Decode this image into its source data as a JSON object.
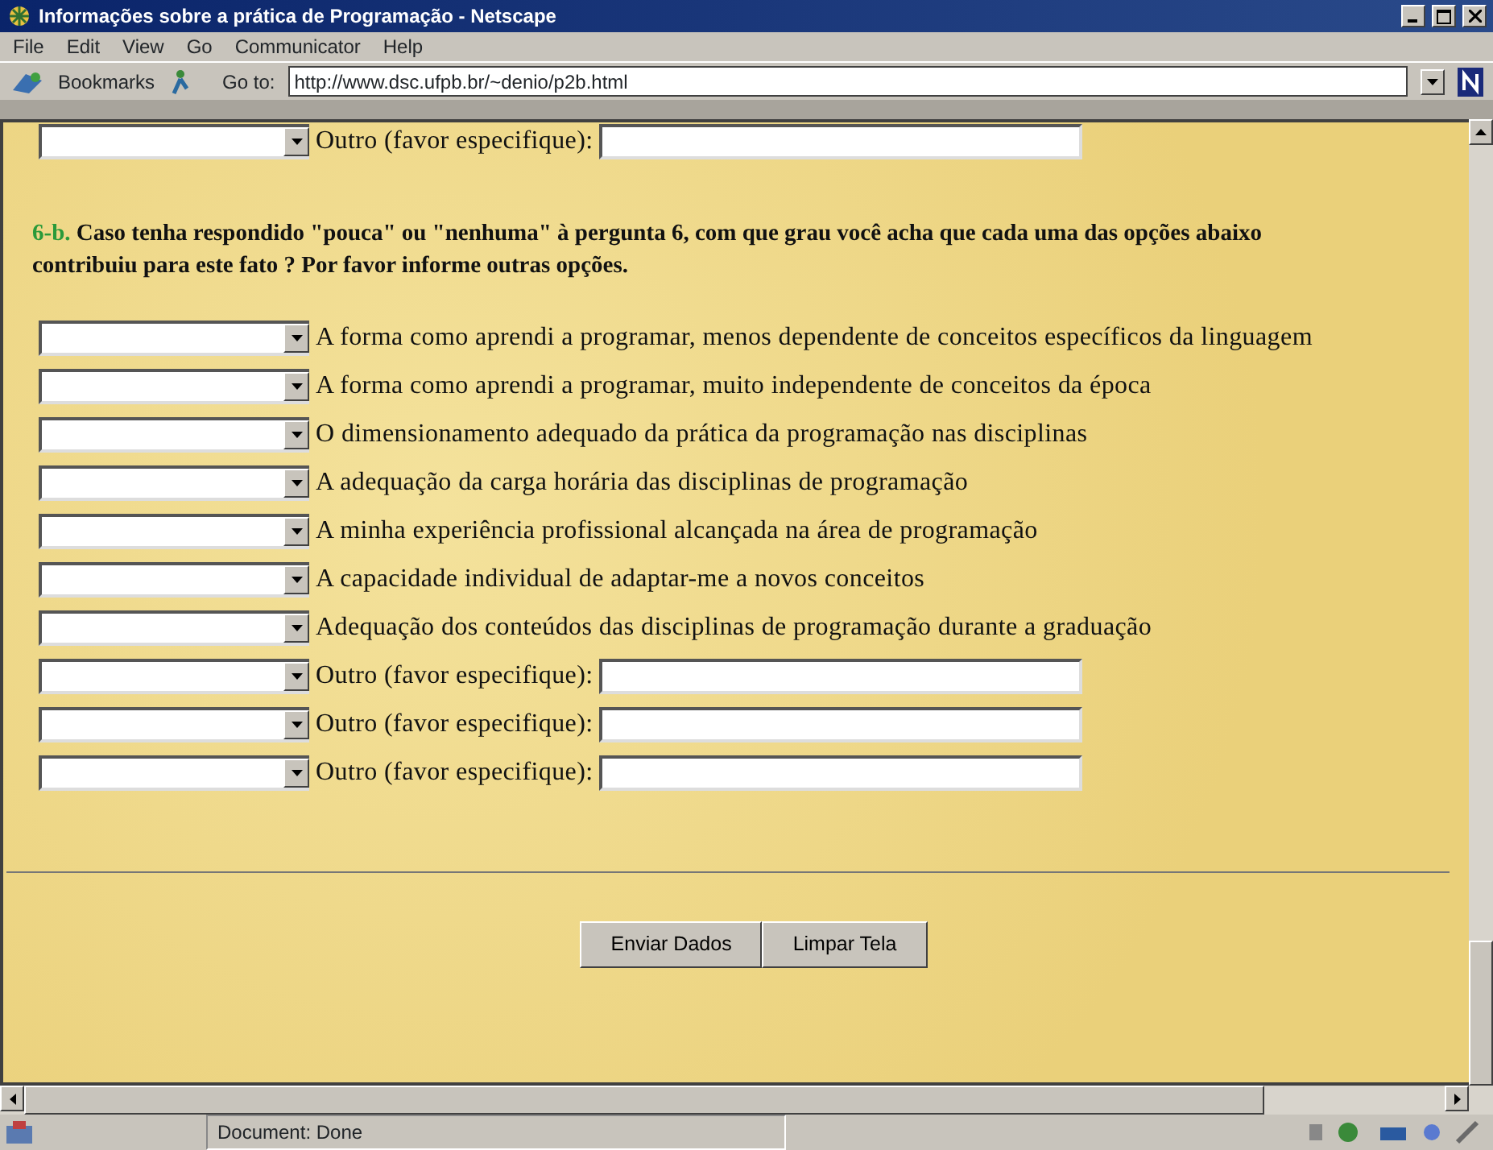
{
  "window": {
    "title": "Informações sobre a prática de Programação - Netscape"
  },
  "menu": [
    "File",
    "Edit",
    "View",
    "Go",
    "Communicator",
    "Help"
  ],
  "toolbar": {
    "bookmarks": "Bookmarks",
    "goto_label": "Go to:",
    "url": "http://www.dsc.ufpb.br/~denio/p2b.html"
  },
  "question": {
    "number": "6-b.",
    "text": "Caso tenha respondido \"pouca\" ou \"nenhuma\" à pergunta 6, com que grau você acha que cada uma das opções abaixo contribuiu para este fato ? Por favor informe outras opções."
  },
  "top_row": {
    "kind": "other",
    "label": "Outro (favor especifique):"
  },
  "rows": [
    {
      "kind": "option",
      "label": "A forma como aprendi a programar, menos dependente de conceitos específicos da linguagem"
    },
    {
      "kind": "option",
      "label": "A forma como aprendi a programar, muito independente de conceitos da época"
    },
    {
      "kind": "option",
      "label": "O dimensionamento adequado da prática da programação nas disciplinas"
    },
    {
      "kind": "option",
      "label": "A adequação da carga horária das disciplinas de programação"
    },
    {
      "kind": "option",
      "label": "A minha experiência profissional alcançada na área de programação"
    },
    {
      "kind": "option",
      "label": "A capacidade individual de adaptar-me a novos conceitos"
    },
    {
      "kind": "option",
      "label": "Adequação dos conteúdos das disciplinas de programação durante a graduação"
    },
    {
      "kind": "other",
      "label": "Outro (favor especifique):"
    },
    {
      "kind": "other",
      "label": "Outro (favor especifique):"
    },
    {
      "kind": "other",
      "label": "Outro (favor especifique):"
    }
  ],
  "buttons": [
    "Enviar Dados",
    "Limpar Tela"
  ],
  "status": "Document: Done"
}
